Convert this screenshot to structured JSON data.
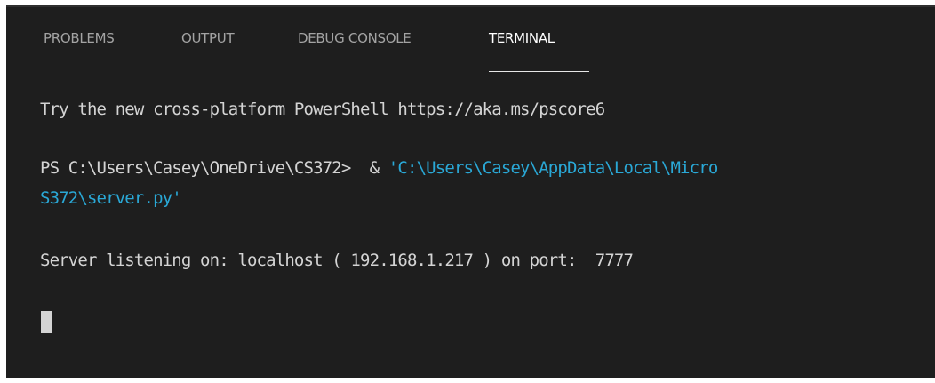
{
  "panel": {
    "tabs": [
      {
        "label": "PROBLEMS",
        "active": false
      },
      {
        "label": "OUTPUT",
        "active": false
      },
      {
        "label": "DEBUG CONSOLE",
        "active": false
      },
      {
        "label": "TERMINAL",
        "active": true
      }
    ]
  },
  "terminal": {
    "intro": "Try the new cross-platform PowerShell https://aka.ms/pscore6",
    "prompt": "PS C:\\Users\\Casey\\OneDrive\\CS372>  & ",
    "command_path_line1": "'C:\\Users\\Casey\\AppData\\Local\\Micro",
    "command_path_line2": "S372\\server.py'",
    "output": "Server listening on: localhost ( 192.168.1.217 ) on port:  7777"
  },
  "colors": {
    "background": "#1e1e1e",
    "text": "#d4d4d4",
    "string": "#2aa8d6",
    "tab_inactive": "#a3a3a3",
    "tab_active": "#ffffff"
  }
}
